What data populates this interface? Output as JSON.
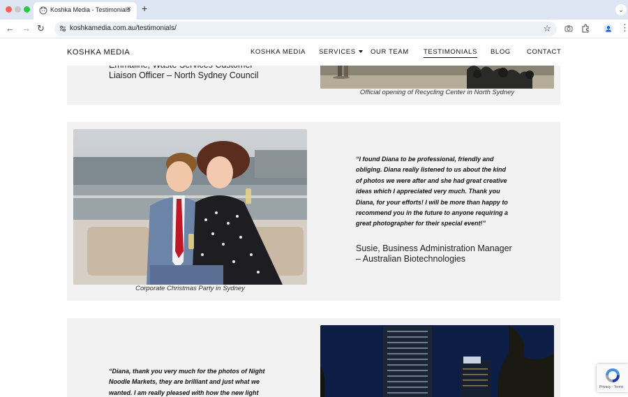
{
  "browser": {
    "tab_title": "Koshka Media - Testimonials",
    "tab_close": "×",
    "new_tab": "+",
    "url": "koshkamedia.com.au/testimonials/"
  },
  "site": {
    "logo": "KOSHKA MEDIA",
    "nav": [
      {
        "label": "KOSHKA MEDIA"
      },
      {
        "label": "SERVICES"
      },
      {
        "label": "OUR TEAM"
      },
      {
        "label": "TESTIMONIALS"
      },
      {
        "label": "BLOG"
      },
      {
        "label": "CONTACT"
      }
    ]
  },
  "testimonials": [
    {
      "attribution_line1": "Emmaline, Waste Services Customer",
      "attribution_line2": "Liaison Officer – North Sydney Council",
      "caption": "Official opening of Recycling Center in North Sydney"
    },
    {
      "quote_lines": [
        "“I found Diana to be professional, friendly and",
        "obliging. Diana really listened to us about the kind",
        "of photos we were after and she had great creative",
        "ideas which I appreciated very much. Thank you",
        "Diana, for your efforts! I will be more than happy to",
        "recommend you in the future to anyone requiring a",
        "great photographer for their special event!”"
      ],
      "attribution_line1": "Susie, Business Administration Manager",
      "attribution_line2": "– Australian Biotechnologies",
      "caption": "Corporate Christmas Party in Sydney"
    },
    {
      "quote_lines": [
        "“Diana, thank you very much for the photos of Night",
        "Noodle Markets, they are brilliant and just what we",
        "wanted. I am really pleased with how the new light"
      ]
    }
  ],
  "recaptcha": {
    "label": "Privacy - Terms"
  }
}
